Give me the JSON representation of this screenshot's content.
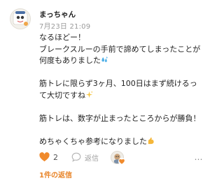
{
  "comment": {
    "author": "まっちゃん",
    "timestamp": "7月23日 21:09",
    "lines": [
      "なるほどー！",
      "ブレークスルーの手前で諦めてしまったことが",
      "何度もありました",
      "",
      "筋トレに限らず3ヶ月、100日はまず続けるっ",
      "て大切ですね",
      "",
      "筋トレは、数字が止まったところからが勝負！",
      "",
      "めちゃくちゃ参考になりました"
    ],
    "emojis": {
      "line3": "sweat-droplets-icon",
      "line6": "sparkles-icon",
      "line10": "flexed-biceps-icon"
    }
  },
  "actions": {
    "like_count": "2",
    "reply_label": "返信",
    "more_label": "…"
  },
  "replies": {
    "label": "1件の返信"
  },
  "colors": {
    "accent": "#e8852a",
    "muted": "#9a9a9a"
  }
}
